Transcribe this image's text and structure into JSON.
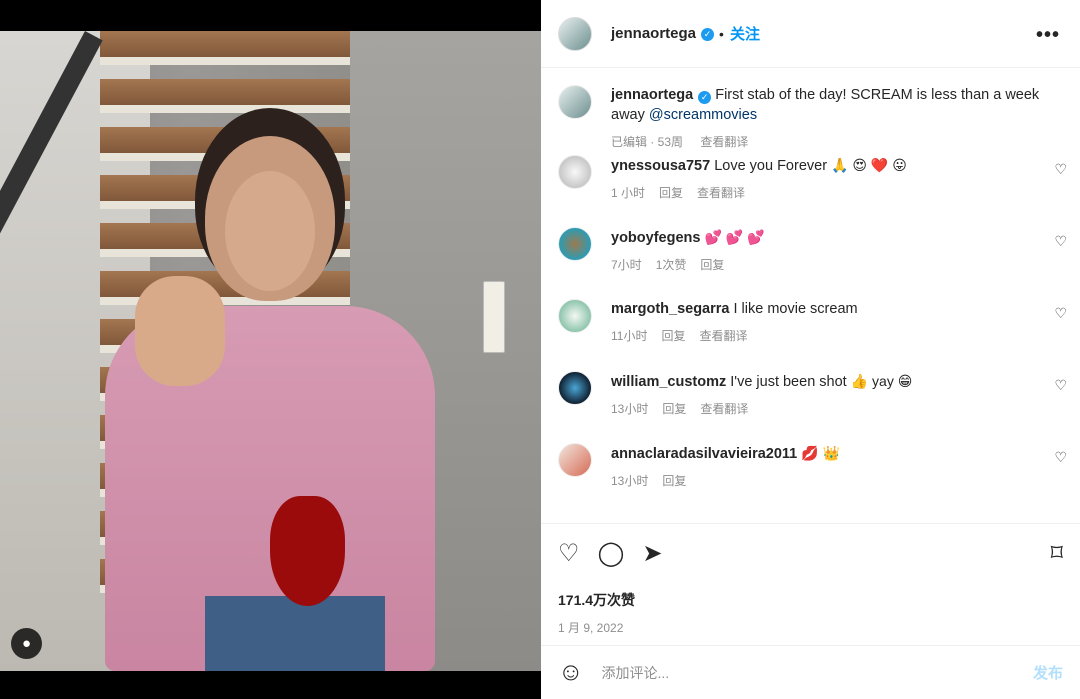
{
  "post": {
    "username": "jennaortega",
    "follow_label": "关注",
    "more_label": "•••",
    "caption": {
      "username": "jennaortega",
      "text": "First stab of the day! SCREAM is less than a week away",
      "mention": "@screammovies",
      "meta_age": "已编辑 · 53周",
      "translate": "查看翻译"
    },
    "comments": [
      {
        "user": "ynessousa757",
        "text": "Love you Forever",
        "emoji": "🙏 😍 ❤️ 😛",
        "time": "1 小时",
        "reply": "回复",
        "translate": "查看翻译"
      },
      {
        "user": "yoboyfegens",
        "text": "",
        "emoji": "💕 💕 💕",
        "time": "7小时",
        "likes": "1次赞",
        "reply": "回复"
      },
      {
        "user": "margoth_segarra",
        "text": "I like movie scream",
        "emoji": "",
        "time": "11小时",
        "reply": "回复",
        "translate": "查看翻译"
      },
      {
        "user": "william_customz",
        "text": "I've just been shot",
        "emoji": "👍 yay 😁",
        "time": "13小时",
        "reply": "回复",
        "translate": "查看翻译"
      },
      {
        "user": "annaclaradasilvavieira2011",
        "text": "",
        "emoji": "💋 👑",
        "time": "13小时",
        "reply": "回复"
      }
    ],
    "likes": "171.4万次赞",
    "date": "1 月 9, 2022",
    "comment_placeholder": "添加评论...",
    "post_button": "发布"
  }
}
